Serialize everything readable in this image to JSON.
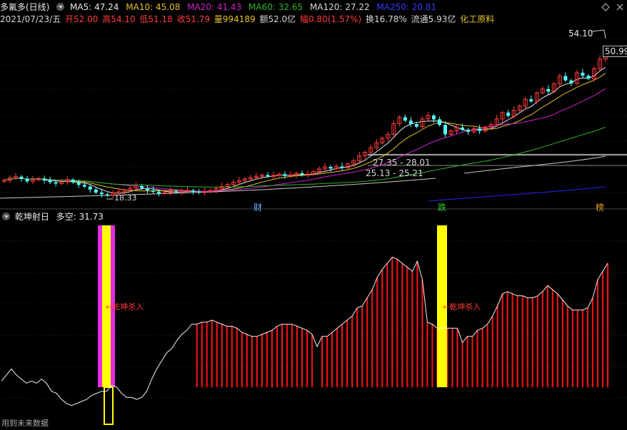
{
  "header": {
    "stock_name": "多氟多(日线)",
    "ma5_label": "MA5: 47.24",
    "ma10_label": "MA10: 45.08",
    "ma20_label": "MA20: 41.43",
    "ma60_label": "MA60: 32.65",
    "ma120_label": "MA120: 27.22",
    "ma250_label": "MA250: 20.81",
    "date": "2021/07/23/五",
    "open": "开52.00",
    "high": "高54.10",
    "low": "低51.18",
    "close": "收51.79",
    "volume": "量994189",
    "amount": "额52.0亿",
    "change": "幅0.80(1.57%)",
    "turnover": "换16.78%",
    "float_cap": "流通5.93亿",
    "sector": "化工原料"
  },
  "colors": {
    "up": "#ff3b3b",
    "down": "#54ffff",
    "ma5": "#e8e8e8",
    "ma10": "#e6c02a",
    "ma20": "#d020d0",
    "ma60": "#2fb52f",
    "ma120": "#c8c8c8",
    "ma250": "#2525ff",
    "signal_yellow": "#ffff00",
    "signal_magenta": "#e22be2"
  },
  "price_panel": {
    "high_marker": "54.10",
    "last_price_box": "50.99",
    "low_marker": "18.33",
    "range1": "27.35 - 28.01",
    "range2": "25.13 - 25.21",
    "event_cai": "财",
    "event_die": "跌",
    "event_bang": "榜"
  },
  "indicator_panel": {
    "title": "乾坤射日",
    "value_label": "多空: 31.73",
    "signal_label_1": "←乾坤杀入",
    "signal_label_2": "←乾坤杀入",
    "footer": "用到未来数据"
  },
  "chart_data": [
    {
      "type": "candlestick",
      "title": "多氟多(日线)",
      "last_bar": {
        "date": "2021/07/23",
        "open": 52.0,
        "high": 54.1,
        "low": 51.18,
        "close": 51.79
      },
      "moving_averages": {
        "MA5": 47.24,
        "MA10": 45.08,
        "MA20": 41.43,
        "MA60": 32.65,
        "MA120": 27.22,
        "MA250": 20.81
      },
      "y_scale": {
        "min": 15.4,
        "max": 58.4
      },
      "close_series": [
        22.3,
        22.8,
        23.1,
        22.6,
        22.0,
        22.4,
        22.7,
        22.2,
        21.8,
        21.5,
        21.9,
        22.4,
        21.8,
        21.2,
        20.8,
        20.1,
        19.4,
        19.0,
        18.8,
        19.3,
        19.6,
        20.0,
        20.4,
        20.9,
        20.4,
        19.9,
        19.6,
        19.2,
        19.4,
        19.7,
        19.5,
        19.8,
        19.9,
        19.6,
        19.4,
        19.6,
        19.9,
        20.3,
        20.8,
        21.3,
        21.8,
        22.2,
        22.6,
        22.9,
        23.2,
        23.5,
        23.2,
        23.4,
        23.7,
        23.3,
        23.5,
        23.9,
        23.5,
        23.7,
        24.3,
        24.9,
        25.4,
        25.0,
        25.5,
        25.2,
        26.1,
        26.8,
        28.0,
        28.8,
        29.9,
        31.0,
        32.1,
        33.0,
        35.5,
        37.0,
        36.2,
        35.4,
        34.8,
        36.6,
        37.4,
        36.5,
        35.2,
        33.0,
        33.8,
        34.6,
        34.1,
        33.6,
        34.3,
        33.8,
        34.7,
        35.3,
        36.6,
        38.1,
        37.3,
        38.6,
        39.6,
        41.2,
        40.7,
        42.7,
        43.6,
        43.0,
        44.8,
        46.6,
        45.6,
        44.9,
        47.4,
        46.7,
        46.0,
        48.3,
        50.6,
        51.79
      ]
    },
    {
      "type": "bar",
      "title": "乾坤射日",
      "value_label": "多空: 31.73",
      "series": [
        {
          "name": "多空",
          "values": [
            3,
            6,
            9,
            6,
            4,
            2,
            3,
            2,
            4,
            2,
            -2,
            -3,
            -6,
            -8,
            -9,
            -8,
            -7,
            -6,
            -4,
            -3,
            -2,
            -2,
            1,
            0,
            -3,
            -5,
            -5,
            -6,
            -5,
            -2,
            4,
            9,
            13,
            17,
            19,
            23,
            26,
            28,
            31,
            31,
            32,
            32,
            33,
            32,
            31,
            30,
            30,
            29,
            27,
            26,
            25,
            25,
            26,
            27,
            28,
            30,
            31,
            31,
            31,
            30,
            29,
            28,
            26,
            20,
            25,
            25,
            27,
            29,
            31,
            33,
            35,
            39,
            40,
            44,
            48,
            54,
            58,
            61,
            64,
            63,
            61,
            59,
            57,
            62,
            53,
            32,
            31,
            29,
            29,
            29,
            29,
            29,
            22,
            25,
            25,
            28,
            29,
            31,
            35,
            40,
            46,
            47,
            46,
            45,
            45,
            44,
            44,
            45,
            47,
            50,
            48,
            46,
            43,
            40,
            38,
            38,
            38,
            39,
            44,
            53,
            57,
            61
          ]
        }
      ],
      "signals": [
        {
          "label": "←乾坤杀入",
          "index": 12
        },
        {
          "label": "←乾坤杀入",
          "index": 80
        }
      ]
    }
  ]
}
